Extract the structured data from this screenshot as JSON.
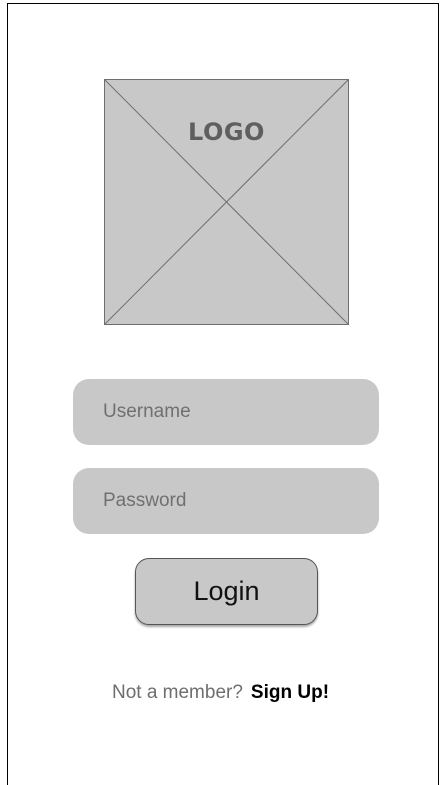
{
  "logo": {
    "label": "LOGO"
  },
  "form": {
    "username_placeholder": "Username",
    "username_value": "",
    "password_placeholder": "Password",
    "password_value": "",
    "login_label": "Login"
  },
  "footer": {
    "prompt": "Not a member?",
    "signup_label": "Sign Up!"
  },
  "colors": {
    "placeholder_fill": "#c8c8c8",
    "text_muted": "#6e6e6e",
    "text_dark": "#000000"
  }
}
